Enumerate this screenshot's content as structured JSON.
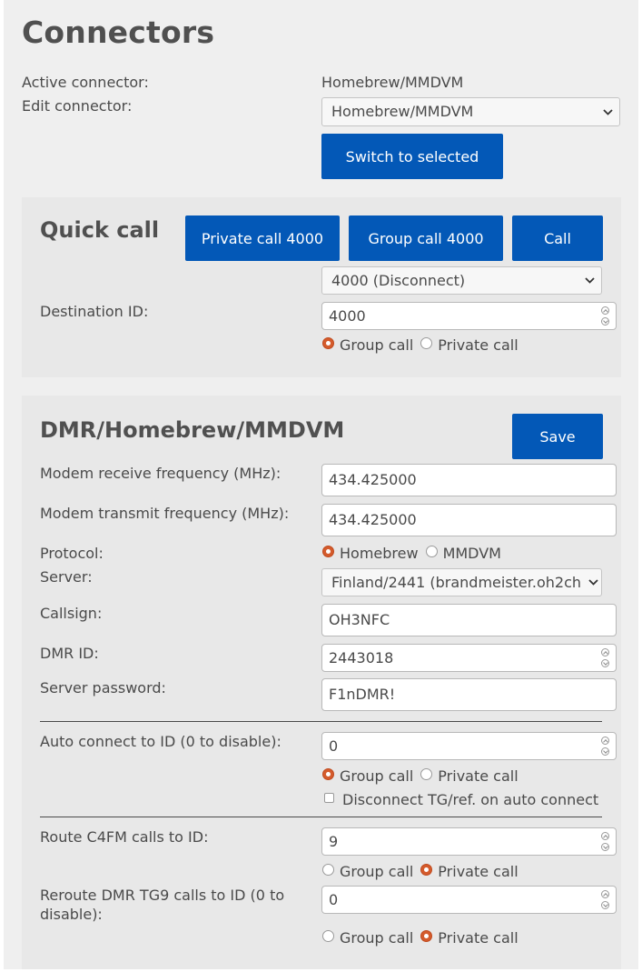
{
  "page_title": "Connectors",
  "connector": {
    "active_label": "Active connector:",
    "active_value": "Homebrew/MMDVM",
    "edit_label": "Edit connector:",
    "edit_value": "Homebrew/MMDVM",
    "switch_button": "Switch to selected"
  },
  "quick_call": {
    "title": "Quick call",
    "private_button": "Private call 4000",
    "group_button": "Group call 4000",
    "call_button": "Call",
    "preset_value": "4000 (Disconnect)",
    "destination_label": "Destination ID:",
    "destination_value": "4000",
    "group_label": "Group call",
    "private_label": "Private call",
    "selected_type": "group"
  },
  "dmr": {
    "title": "DMR/Homebrew/MMDVM",
    "save_button": "Save",
    "rx_label": "Modem receive frequency (MHz):",
    "rx_value": "434.425000",
    "tx_label": "Modem transmit frequency (MHz):",
    "tx_value": "434.425000",
    "protocol_label": "Protocol:",
    "protocol_homebrew": "Homebrew",
    "protocol_mmdvm": "MMDVM",
    "protocol_selected": "homebrew",
    "server_label": "Server:",
    "server_value": "Finland/2441 (brandmeister.oh2ch",
    "callsign_label": "Callsign:",
    "callsign_value": "OH3NFC",
    "dmr_id_label": "DMR ID:",
    "dmr_id_value": "2443018",
    "password_label": "Server password:",
    "password_value": "F1nDMR!",
    "auto_connect_label": "Auto connect to ID (0 to disable):",
    "auto_connect_value": "0",
    "auto_group_label": "Group call",
    "auto_private_label": "Private call",
    "auto_selected": "group",
    "disconnect_label": "Disconnect TG/ref. on auto connect",
    "disconnect_checked": false,
    "c4fm_label": "Route C4FM calls to ID:",
    "c4fm_value": "9",
    "c4fm_group_label": "Group call",
    "c4fm_private_label": "Private call",
    "c4fm_selected": "private",
    "tg9_label": "Reroute DMR TG9 calls to ID (0 to disable):",
    "tg9_value": "0",
    "tg9_group_label": "Group call",
    "tg9_private_label": "Private call",
    "tg9_selected": "private"
  },
  "colors": {
    "accent": "#0358b7",
    "radio_selected": "#d45b2c",
    "panel": "#e8e8e8",
    "page": "#efefef"
  }
}
